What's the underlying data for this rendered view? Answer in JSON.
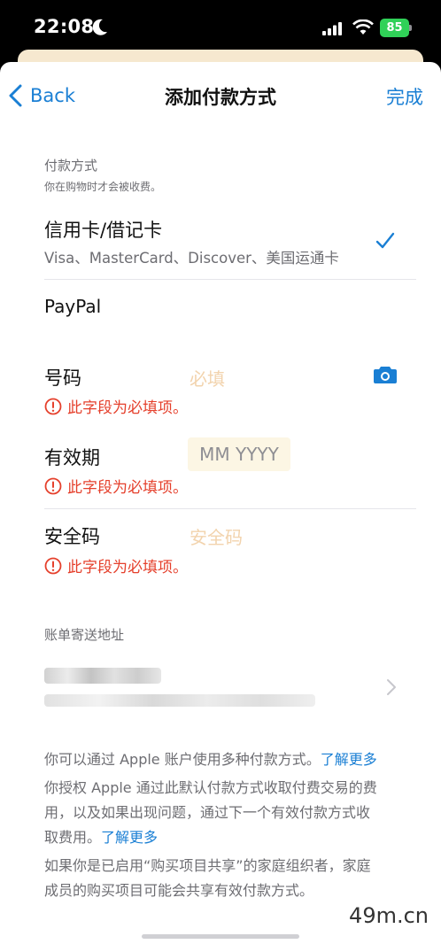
{
  "status_bar": {
    "time": "22:08",
    "battery": "85"
  },
  "nav": {
    "back_label": "Back",
    "title": "添加付款方式",
    "done_label": "完成"
  },
  "payment_section": {
    "header": "付款方式",
    "subheader": "你在购物时才会被收费。",
    "options": [
      {
        "title": "信用卡/借记卡",
        "subtitle": "Visa、MasterCard、Discover、美国运通卡",
        "selected": true
      },
      {
        "title": "PayPal",
        "selected": false
      }
    ]
  },
  "fields": {
    "number": {
      "label": "号码",
      "placeholder": "必填",
      "error": "此字段为必填项。"
    },
    "expiry": {
      "label": "有效期",
      "placeholder": "MM YYYY",
      "error": "此字段为必填项。"
    },
    "cvv": {
      "label": "安全码",
      "placeholder": "安全码",
      "error": "此字段为必填项。"
    }
  },
  "billing": {
    "header": "账单寄送地址"
  },
  "footer": {
    "p1_text": "你可以通过 Apple 账户使用多种付款方式。",
    "p1_link": "了解更多",
    "p2_line1": "你授权 Apple 通过此默认付款方式收取付费交易的费",
    "p2_line2": "用，以及如果出现问题，通过下一个有效付款方式收",
    "p2_line3": "取费用。",
    "p2_link": "了解更多",
    "p3_line1": "如果你是已启用“购买项目共享”的家庭组织者，家庭",
    "p3_line2": "成员的购买项目可能会共享有效付款方式。"
  },
  "watermark": "49m.cn",
  "colors": {
    "accent": "#1a7fd4",
    "error": "#e5402c",
    "battery": "#30d158"
  }
}
